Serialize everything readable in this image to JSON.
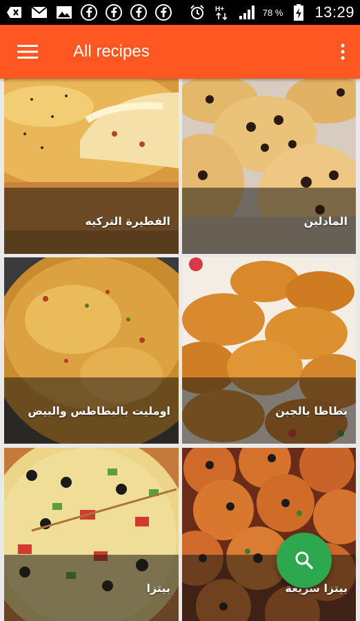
{
  "status_bar": {
    "left_icons": [
      "add-icon",
      "mail-icon",
      "image-icon",
      "facebook-icon",
      "facebook-icon",
      "facebook-icon",
      "facebook-icon"
    ],
    "battery_percent": "78 %",
    "time": "13:29"
  },
  "app_bar": {
    "title": "All recipes",
    "color": "#ff5722"
  },
  "recipes": [
    {
      "title": "الفطيرة التركيه"
    },
    {
      "title": "المادلين"
    },
    {
      "title": "اومليت بالبطاطس والبيض"
    },
    {
      "title": "بطاطا بالجبن"
    },
    {
      "title": "بيتزا"
    },
    {
      "title": "بيتزا سريعة"
    }
  ],
  "fab": {
    "icon": "search-icon",
    "color": "#2ea84f"
  }
}
